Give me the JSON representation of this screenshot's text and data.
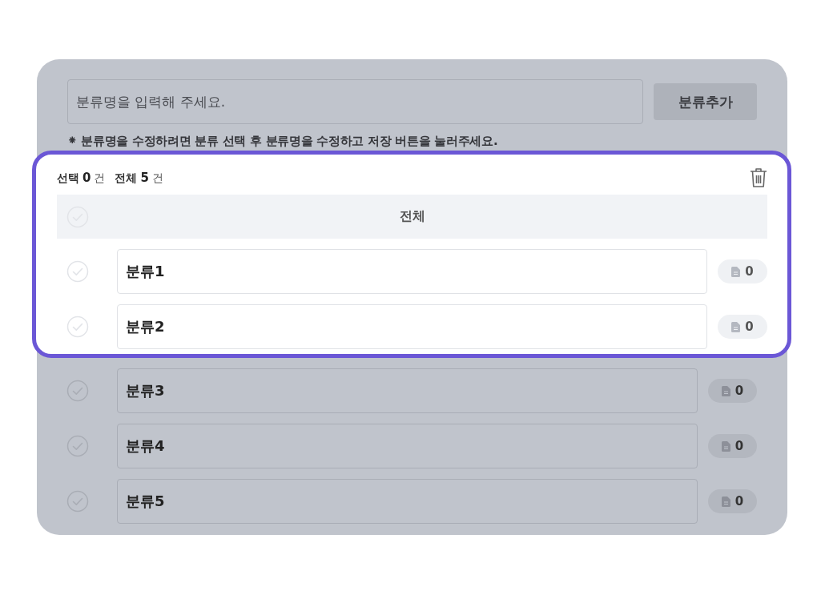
{
  "input": {
    "placeholder": "분류명을 입력해 주세요."
  },
  "add_button": "분류추가",
  "hint": "⁕ 분류명을 수정하려면 분류 선택 후 분류명을 수정하고 저장 버튼을 눌러주세요.",
  "summary": {
    "selected_label": "선택",
    "selected_count": "0",
    "selected_unit": "건",
    "total_label": "전체",
    "total_count": "5",
    "total_unit": "건"
  },
  "all_row": {
    "label": "전체",
    "checked": false
  },
  "categories": [
    {
      "name": "분류1",
      "count": "0",
      "checked": false,
      "highlighted": true
    },
    {
      "name": "분류2",
      "count": "0",
      "checked": false,
      "highlighted": true
    },
    {
      "name": "분류3",
      "count": "0",
      "checked": false,
      "highlighted": false
    },
    {
      "name": "분류4",
      "count": "0",
      "checked": false,
      "highlighted": false
    },
    {
      "name": "분류5",
      "count": "0",
      "checked": false,
      "highlighted": false
    }
  ]
}
